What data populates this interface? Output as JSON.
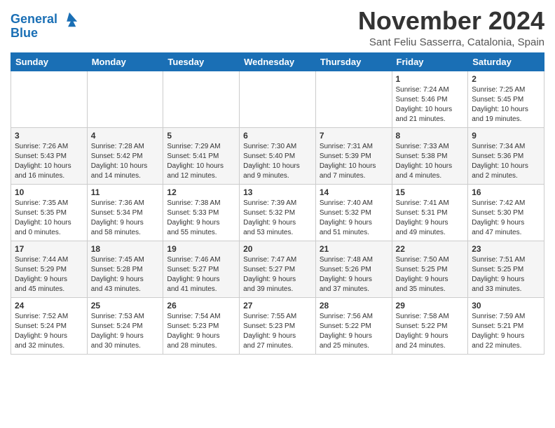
{
  "header": {
    "logo_line1": "General",
    "logo_line2": "Blue",
    "month_year": "November 2024",
    "location": "Sant Feliu Sasserra, Catalonia, Spain"
  },
  "weekdays": [
    "Sunday",
    "Monday",
    "Tuesday",
    "Wednesday",
    "Thursday",
    "Friday",
    "Saturday"
  ],
  "weeks": [
    [
      {
        "day": "",
        "info": ""
      },
      {
        "day": "",
        "info": ""
      },
      {
        "day": "",
        "info": ""
      },
      {
        "day": "",
        "info": ""
      },
      {
        "day": "",
        "info": ""
      },
      {
        "day": "1",
        "info": "Sunrise: 7:24 AM\nSunset: 5:46 PM\nDaylight: 10 hours\nand 21 minutes."
      },
      {
        "day": "2",
        "info": "Sunrise: 7:25 AM\nSunset: 5:45 PM\nDaylight: 10 hours\nand 19 minutes."
      }
    ],
    [
      {
        "day": "3",
        "info": "Sunrise: 7:26 AM\nSunset: 5:43 PM\nDaylight: 10 hours\nand 16 minutes."
      },
      {
        "day": "4",
        "info": "Sunrise: 7:28 AM\nSunset: 5:42 PM\nDaylight: 10 hours\nand 14 minutes."
      },
      {
        "day": "5",
        "info": "Sunrise: 7:29 AM\nSunset: 5:41 PM\nDaylight: 10 hours\nand 12 minutes."
      },
      {
        "day": "6",
        "info": "Sunrise: 7:30 AM\nSunset: 5:40 PM\nDaylight: 10 hours\nand 9 minutes."
      },
      {
        "day": "7",
        "info": "Sunrise: 7:31 AM\nSunset: 5:39 PM\nDaylight: 10 hours\nand 7 minutes."
      },
      {
        "day": "8",
        "info": "Sunrise: 7:33 AM\nSunset: 5:38 PM\nDaylight: 10 hours\nand 4 minutes."
      },
      {
        "day": "9",
        "info": "Sunrise: 7:34 AM\nSunset: 5:36 PM\nDaylight: 10 hours\nand 2 minutes."
      }
    ],
    [
      {
        "day": "10",
        "info": "Sunrise: 7:35 AM\nSunset: 5:35 PM\nDaylight: 10 hours\nand 0 minutes."
      },
      {
        "day": "11",
        "info": "Sunrise: 7:36 AM\nSunset: 5:34 PM\nDaylight: 9 hours\nand 58 minutes."
      },
      {
        "day": "12",
        "info": "Sunrise: 7:38 AM\nSunset: 5:33 PM\nDaylight: 9 hours\nand 55 minutes."
      },
      {
        "day": "13",
        "info": "Sunrise: 7:39 AM\nSunset: 5:32 PM\nDaylight: 9 hours\nand 53 minutes."
      },
      {
        "day": "14",
        "info": "Sunrise: 7:40 AM\nSunset: 5:32 PM\nDaylight: 9 hours\nand 51 minutes."
      },
      {
        "day": "15",
        "info": "Sunrise: 7:41 AM\nSunset: 5:31 PM\nDaylight: 9 hours\nand 49 minutes."
      },
      {
        "day": "16",
        "info": "Sunrise: 7:42 AM\nSunset: 5:30 PM\nDaylight: 9 hours\nand 47 minutes."
      }
    ],
    [
      {
        "day": "17",
        "info": "Sunrise: 7:44 AM\nSunset: 5:29 PM\nDaylight: 9 hours\nand 45 minutes."
      },
      {
        "day": "18",
        "info": "Sunrise: 7:45 AM\nSunset: 5:28 PM\nDaylight: 9 hours\nand 43 minutes."
      },
      {
        "day": "19",
        "info": "Sunrise: 7:46 AM\nSunset: 5:27 PM\nDaylight: 9 hours\nand 41 minutes."
      },
      {
        "day": "20",
        "info": "Sunrise: 7:47 AM\nSunset: 5:27 PM\nDaylight: 9 hours\nand 39 minutes."
      },
      {
        "day": "21",
        "info": "Sunrise: 7:48 AM\nSunset: 5:26 PM\nDaylight: 9 hours\nand 37 minutes."
      },
      {
        "day": "22",
        "info": "Sunrise: 7:50 AM\nSunset: 5:25 PM\nDaylight: 9 hours\nand 35 minutes."
      },
      {
        "day": "23",
        "info": "Sunrise: 7:51 AM\nSunset: 5:25 PM\nDaylight: 9 hours\nand 33 minutes."
      }
    ],
    [
      {
        "day": "24",
        "info": "Sunrise: 7:52 AM\nSunset: 5:24 PM\nDaylight: 9 hours\nand 32 minutes."
      },
      {
        "day": "25",
        "info": "Sunrise: 7:53 AM\nSunset: 5:24 PM\nDaylight: 9 hours\nand 30 minutes."
      },
      {
        "day": "26",
        "info": "Sunrise: 7:54 AM\nSunset: 5:23 PM\nDaylight: 9 hours\nand 28 minutes."
      },
      {
        "day": "27",
        "info": "Sunrise: 7:55 AM\nSunset: 5:23 PM\nDaylight: 9 hours\nand 27 minutes."
      },
      {
        "day": "28",
        "info": "Sunrise: 7:56 AM\nSunset: 5:22 PM\nDaylight: 9 hours\nand 25 minutes."
      },
      {
        "day": "29",
        "info": "Sunrise: 7:58 AM\nSunset: 5:22 PM\nDaylight: 9 hours\nand 24 minutes."
      },
      {
        "day": "30",
        "info": "Sunrise: 7:59 AM\nSunset: 5:21 PM\nDaylight: 9 hours\nand 22 minutes."
      }
    ]
  ]
}
